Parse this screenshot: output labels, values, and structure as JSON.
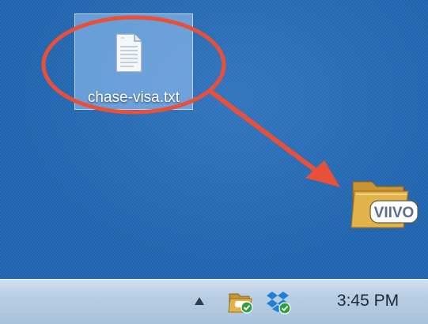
{
  "desktop": {
    "file": {
      "name": "chase-visa.txt",
      "icon": "text-file-icon",
      "selected": true
    },
    "app_folder": {
      "label": "VIIVO",
      "icon": "viivo-folder-icon"
    },
    "annotation": {
      "shape": "circle-with-arrow",
      "color": "#e8503a"
    }
  },
  "taskbar": {
    "tray": {
      "icons": [
        "show-hidden-icons-arrow",
        "viivo-tray-icon",
        "dropbox-tray-icon"
      ]
    },
    "clock": "3:45 PM"
  }
}
